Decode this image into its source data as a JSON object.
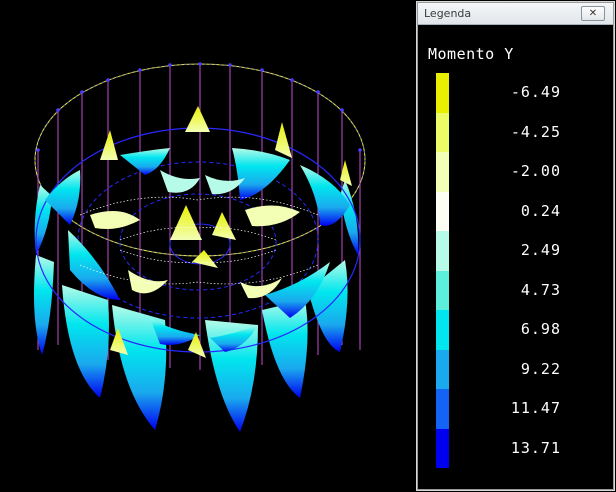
{
  "legend": {
    "window_title": "Legenda",
    "close_icon": "close-icon",
    "heading": "Momento Y",
    "items": [
      {
        "value": "-6.49",
        "color": "#e8f000"
      },
      {
        "value": "-4.25",
        "color": "#ecfb66"
      },
      {
        "value": "-2.00",
        "color": "#f3ffb5"
      },
      {
        "value": "0.24",
        "color": "#fdfff5"
      },
      {
        "value": "2.49",
        "color": "#b6fbe8"
      },
      {
        "value": "4.73",
        "color": "#5cf0dc"
      },
      {
        "value": "6.98",
        "color": "#00e6ee"
      },
      {
        "value": "9.22",
        "color": "#1aa9ee"
      },
      {
        "value": "11.47",
        "color": "#1463f5"
      },
      {
        "value": "13.71",
        "color": "#0000f0"
      }
    ]
  }
}
